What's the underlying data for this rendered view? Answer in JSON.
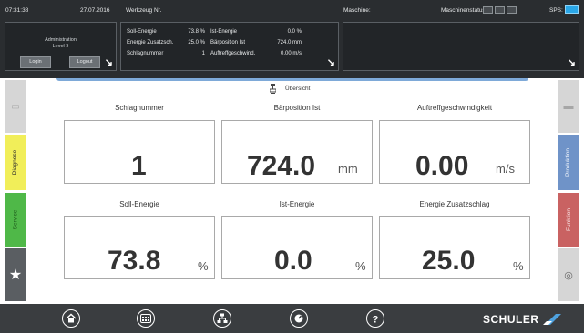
{
  "status_bar": {
    "time": "07:31:38",
    "date": "27.07.2016",
    "tool_label": "Werkzeug Nr.",
    "machine_label": "Maschine:",
    "machine_status_label": "Maschinenstatus:",
    "sps_label": "SPS:"
  },
  "login_panel": {
    "user": "Administration",
    "level": "Level 9",
    "login_button": "Login",
    "logout_button": "Logout"
  },
  "energy_panel": {
    "rows": [
      {
        "label": "Soll-Energie",
        "value": "73.8 %",
        "label2": "Ist-Energie",
        "value2": "0.0 %"
      },
      {
        "label": "Energie Zusatzsch.",
        "value": "25.0 %",
        "label2": "Bärposition Ist",
        "value2": "724.0 mm"
      },
      {
        "label": "Schlagnummer",
        "value": "1",
        "label2": "Auftreffgeschwind.",
        "value2": "0.00 m/s"
      }
    ]
  },
  "breadcrumb": {
    "title": "Übersicht"
  },
  "side_tabs": {
    "left": [
      "Diagnose",
      "Service"
    ],
    "right": [
      "Produktion",
      "Funktion"
    ]
  },
  "cards": [
    {
      "title": "Schlagnummer",
      "value": "1",
      "unit": ""
    },
    {
      "title": "Bärposition Ist",
      "value": "724.0",
      "unit": "mm"
    },
    {
      "title": "Auftreffgeschwindigkeit",
      "value": "0.00",
      "unit": "m/s"
    },
    {
      "title": "Soll-Energie",
      "value": "73.8",
      "unit": "%"
    },
    {
      "title": "Ist-Energie",
      "value": "0.0",
      "unit": "%"
    },
    {
      "title": "Energie Zusatzschlag",
      "value": "25.0",
      "unit": "%"
    }
  ],
  "bottom_nav": {
    "icons": [
      "home-icon",
      "keypad-icon",
      "network-icon",
      "dial-icon",
      "help-icon"
    ],
    "brand": "SCHULER"
  },
  "colors": {
    "sps_indicator": "#2aa7e8",
    "diagnose_tab": "#f1ee59",
    "service_tab": "#4fb848",
    "produktion_tab": "#6f93c8",
    "funktion_tab": "#c96262",
    "brand_blue": "#4fa3e0"
  }
}
